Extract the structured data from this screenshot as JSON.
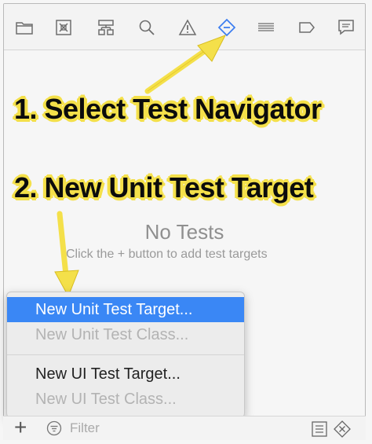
{
  "toolbar": {
    "icons": [
      "folder-icon",
      "source-control-icon",
      "symbol-icon",
      "find-icon",
      "issue-warning-icon",
      "test-navigator-icon",
      "debug-icon",
      "breakpoint-icon",
      "report-icon"
    ],
    "active_color": "#3a7cf0"
  },
  "empty_state": {
    "title": "No Tests",
    "subtitle": "Click the + button to add test targets"
  },
  "annotations": {
    "step1": "1. Select Test Navigator",
    "step2": "2. New Unit Test Target",
    "color": "#f4e04a"
  },
  "menu": {
    "items": [
      {
        "label": "New Unit Test Target...",
        "state": "selected"
      },
      {
        "label": "New Unit Test Class...",
        "state": "disabled"
      },
      {
        "label": "New UI Test Target...",
        "state": "enabled"
      },
      {
        "label": "New UI Test Class...",
        "state": "disabled"
      }
    ],
    "highlight_color": "#3a87f5"
  },
  "bottom_bar": {
    "add_label": "+",
    "filter_placeholder": "Filter"
  }
}
